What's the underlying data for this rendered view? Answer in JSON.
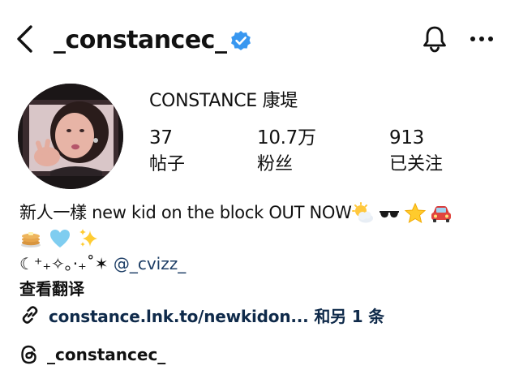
{
  "header": {
    "username": "_constancec_",
    "icons": {
      "back": "chevron-left-icon",
      "verified": "verified-badge-icon",
      "notifications": "bell-icon",
      "more": "more-horizontal-icon"
    },
    "accent_color": "#3897f0"
  },
  "profile": {
    "display_name": "CONSTANCE 康堤",
    "stats": {
      "posts": {
        "value": "37",
        "label": "帖子"
      },
      "followers": {
        "value": "10.7万",
        "label": "粉丝"
      },
      "following": {
        "value": "913",
        "label": "已关注"
      }
    }
  },
  "bio": {
    "line1": "新人一樣 new kid on the block OUT NOW",
    "line1_emojis": [
      "sun-behind-cloud-icon",
      "sunglasses-icon",
      "star-icon",
      "car-icon"
    ],
    "line2_emojis": [
      "pancakes-icon",
      "light-blue-heart-icon",
      "sparkles-icon"
    ],
    "mention_prefix": "☾⁺₊✧｡·₊˚✶",
    "mention": "@_cvizz_",
    "translate_label": "查看翻译"
  },
  "link": {
    "icon": "link-icon",
    "text": "constance.lnk.to/newkidon... 和另 1 条"
  },
  "threads": {
    "icon": "threads-icon",
    "username": "_constancec_"
  }
}
